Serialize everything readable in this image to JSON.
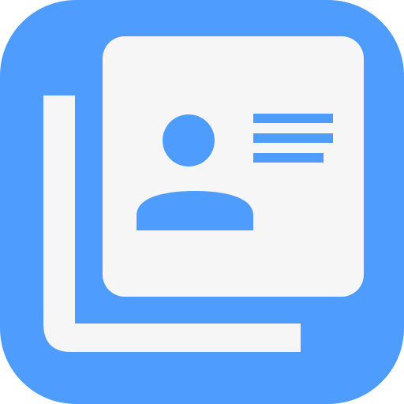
{
  "app_icon": {
    "name": "contacts-app-icon",
    "colors": {
      "background": "#4f9cff",
      "card": "#f6f6f6",
      "accent": "#4f9cff"
    }
  }
}
